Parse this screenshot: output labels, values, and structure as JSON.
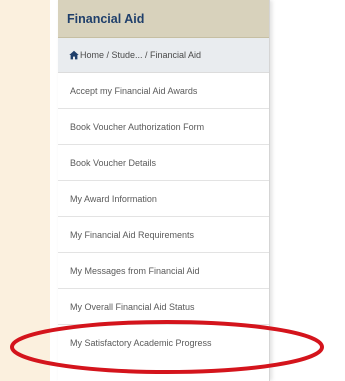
{
  "panel": {
    "title": "Financial Aid",
    "breadcrumb": "Home / Stude... / Financial Aid"
  },
  "menu": {
    "items": [
      {
        "label": "Accept my Financial Aid Awards"
      },
      {
        "label": "Book Voucher Authorization Form"
      },
      {
        "label": "Book Voucher Details"
      },
      {
        "label": "My Award Information"
      },
      {
        "label": "My Financial Aid Requirements"
      },
      {
        "label": "My Messages from Financial Aid"
      },
      {
        "label": "My Overall Financial Aid Status"
      },
      {
        "label": "My Satisfactory Academic Progress"
      }
    ]
  },
  "colors": {
    "header_bg": "#d8d2bc",
    "header_text": "#1f3f6b",
    "highlight": "#d4141c",
    "left_strip": "#fbf0de"
  },
  "icons": {
    "breadcrumb_home": "home-icon",
    "annotation": "highlight-circle"
  }
}
